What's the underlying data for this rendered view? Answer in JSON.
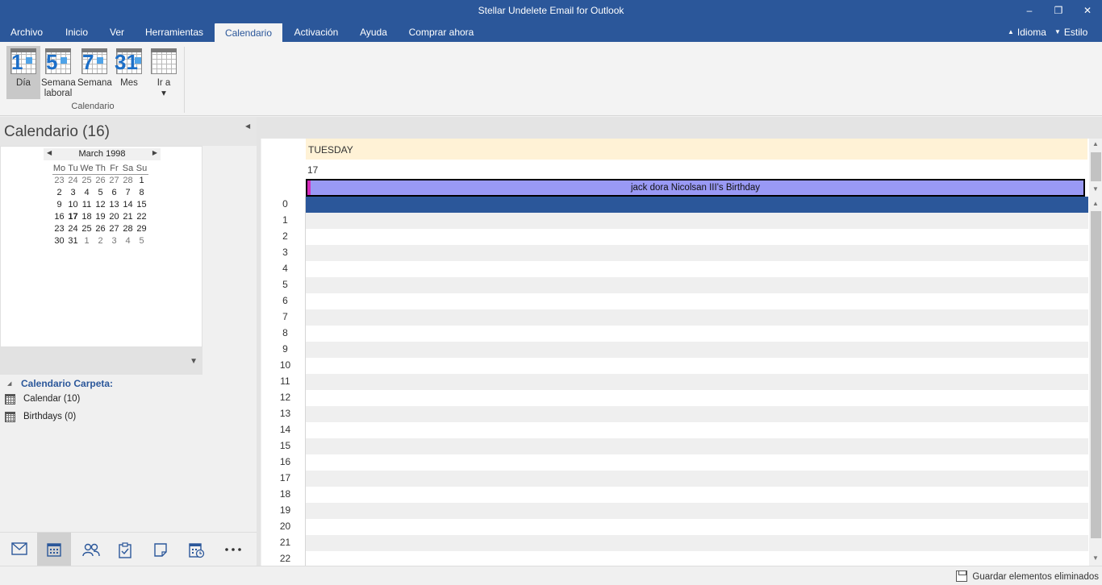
{
  "window": {
    "title": "Stellar Undelete Email for Outlook",
    "minimize": "–",
    "restore": "❐",
    "close": "✕"
  },
  "menu": {
    "items": [
      "Archivo",
      "Inicio",
      "Ver",
      "Herramientas",
      "Calendario",
      "Activación",
      "Ayuda",
      "Comprar ahora"
    ],
    "active": "Calendario",
    "language": "Idioma",
    "style": "Estilo"
  },
  "ribbon": {
    "buttons": [
      {
        "label": "Día",
        "number": "1",
        "icon": "calendar-day-icon"
      },
      {
        "label": "Semana laboral",
        "number": "5",
        "icon": "calendar-workweek-icon"
      },
      {
        "label": "Semana",
        "number": "7",
        "icon": "calendar-week-icon"
      },
      {
        "label": "Mes",
        "number": "31",
        "icon": "calendar-month-icon"
      },
      {
        "label": "Ir a",
        "number": "",
        "icon": "calendar-goto-icon"
      }
    ],
    "active": "Día",
    "group_label": "Calendario"
  },
  "left_panel": {
    "title": "Calendario (16)",
    "mini_calendar": {
      "month_label": "March 1998",
      "weekdays": [
        "Mo",
        "Tu",
        "We",
        "Th",
        "Fr",
        "Sa",
        "Su"
      ],
      "weeks": [
        [
          "23",
          "24",
          "25",
          "26",
          "27",
          "28",
          "1"
        ],
        [
          "2",
          "3",
          "4",
          "5",
          "6",
          "7",
          "8"
        ],
        [
          "9",
          "10",
          "11",
          "12",
          "13",
          "14",
          "15"
        ],
        [
          "16",
          "17",
          "18",
          "19",
          "20",
          "21",
          "22"
        ],
        [
          "23",
          "24",
          "25",
          "26",
          "27",
          "28",
          "29"
        ],
        [
          "30",
          "31",
          "1",
          "2",
          "3",
          "4",
          "5"
        ]
      ],
      "other_month": [
        [
          0,
          0
        ],
        [
          0,
          1
        ],
        [
          0,
          2
        ],
        [
          0,
          3
        ],
        [
          0,
          4
        ],
        [
          0,
          5
        ],
        [
          5,
          2
        ],
        [
          5,
          3
        ],
        [
          5,
          4
        ],
        [
          5,
          5
        ],
        [
          5,
          6
        ]
      ],
      "today": [
        3,
        1
      ]
    },
    "folder_header": "Calendario Carpeta:",
    "folders": [
      {
        "label": "Calendar (10)"
      },
      {
        "label": "Birthdays (0)"
      }
    ]
  },
  "bottom_nav": {
    "items": [
      "mail-icon",
      "calendar-icon",
      "people-icon",
      "tasks-icon",
      "notes-icon",
      "journal-icon",
      "more-icon"
    ],
    "active": "calendar-icon"
  },
  "day_view": {
    "day_name": "TUESDAY",
    "day_number": "17",
    "all_day_event": "jack dora Nicolsan III's Birthday",
    "hours": [
      "0",
      "1",
      "2",
      "3",
      "4",
      "5",
      "6",
      "7",
      "8",
      "9",
      "10",
      "11",
      "12",
      "13",
      "14",
      "15",
      "16",
      "17",
      "18",
      "19",
      "20",
      "21",
      "22"
    ],
    "selected_hour": "0"
  },
  "colors": {
    "accent": "#2b579a",
    "event": "#9999f5",
    "event_marker": "#d42cbd",
    "day_header": "#fff2d6"
  },
  "status": {
    "save_label": "Guardar elementos eliminados"
  }
}
